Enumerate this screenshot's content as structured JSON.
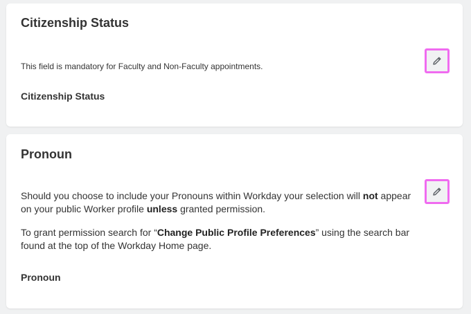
{
  "citizenship": {
    "title": "Citizenship Status",
    "note": "This field is mandatory for Faculty and Non-Faculty appointments.",
    "field_label": "Citizenship Status",
    "edit_icon": "pencil-icon"
  },
  "pronoun": {
    "title": "Pronoun",
    "para1": {
      "a": "Should you choose to include your Pronouns within Workday your selection will ",
      "b": "not",
      "c": " appear on your public Worker profile ",
      "d": "unless",
      "e": " granted permission."
    },
    "para2": {
      "a": "To grant permission search for “",
      "b": "Change Public Profile Preferences",
      "c": "” using the search bar found at the top of the Workday Home page."
    },
    "field_label": "Pronoun",
    "edit_icon": "pencil-icon"
  },
  "colors": {
    "background": "#f0f1f2",
    "card": "#ffffff",
    "text": "#333333",
    "highlight_border": "#f06bf0"
  }
}
